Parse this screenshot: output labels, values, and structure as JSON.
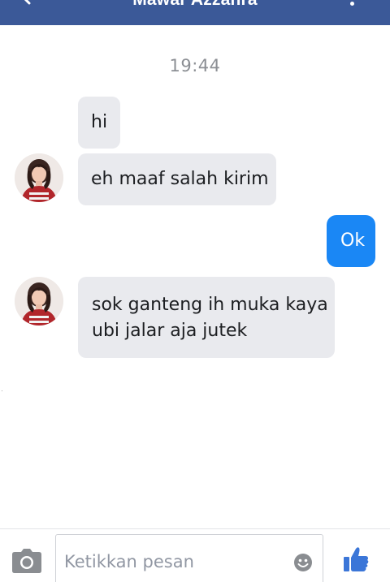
{
  "header": {
    "title": "Mawar Azzahra",
    "back_icon": "back-arrow-icon",
    "menu_icon": "more-vertical-icon",
    "background_color": "#3b5998"
  },
  "conversation": {
    "timestamp": "19:44",
    "messages": [
      {
        "sender": "Mawar Azzahra",
        "direction": "incoming",
        "text": "hi"
      },
      {
        "sender": "Mawar Azzahra",
        "direction": "incoming",
        "text": "eh maaf salah kirim"
      },
      {
        "sender": "me",
        "direction": "outgoing",
        "text": "Ok"
      },
      {
        "sender": "Mawar Azzahra",
        "direction": "incoming",
        "text": "sok ganteng ih muka kaya ubi jalar aja jutek"
      }
    ],
    "incoming_bubble_color": "#e9eaee",
    "outgoing_bubble_color": "#1a87f5"
  },
  "composer": {
    "placeholder": "Ketikkan pesan",
    "value": "",
    "camera_icon": "camera-icon",
    "emoji_icon": "emoji-icon",
    "like_icon": "thumbs-up-icon",
    "accent_color": "#3b76d8"
  }
}
